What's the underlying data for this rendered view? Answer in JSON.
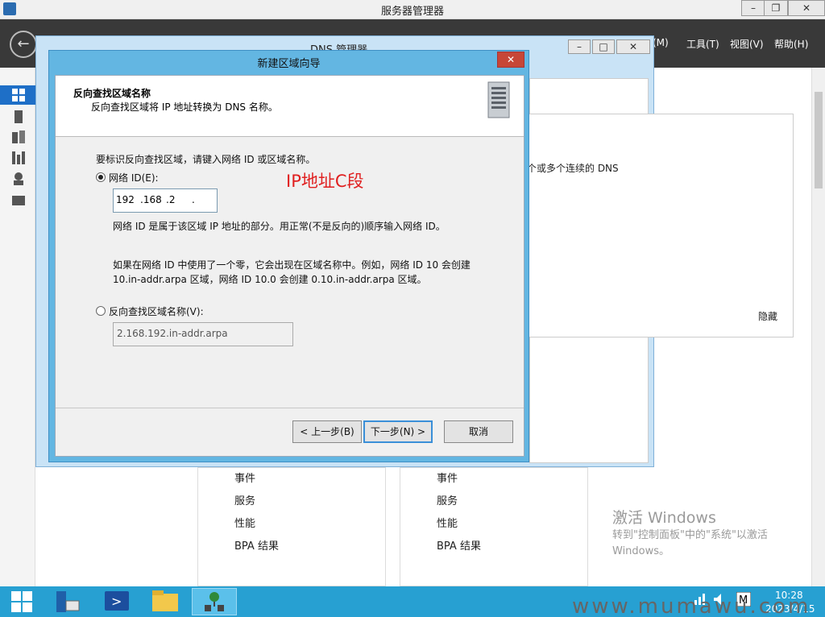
{
  "server_manager": {
    "title": "服务器管理器",
    "menus": [
      "(M)",
      "工具(T)",
      "视图(V)",
      "帮助(H)"
    ],
    "tiles": [
      {
        "items": [
          "事件",
          "服务",
          "性能",
          "BPA 结果"
        ]
      },
      {
        "items": [
          "事件",
          "服务",
          "性能",
          "BPA 结果"
        ]
      }
    ],
    "activation": {
      "line1": "激活 Windows",
      "line2": "转到\"控制面板\"中的\"系统\"以激活",
      "line3": "Windows。"
    }
  },
  "dns_manager": {
    "title": "DNS 管理器",
    "panel_text": "个或多个连续的 DNS",
    "hide_label": "隐藏"
  },
  "wizard": {
    "title": "新建区域向导",
    "close_glyph": "✕",
    "header_title": "反向查找区域名称",
    "header_subtitle": "反向查找区域将 IP 地址转换为 DNS 名称。",
    "instruction": "要标识反向查找区域，请键入网络 ID 或区域名称。",
    "network_id_label": "网络 ID(E):",
    "ip_octets": [
      "192",
      ".168",
      ".2",
      "."
    ],
    "annotation": "IP地址C段",
    "network_id_note": "网络 ID 是属于该区域 IP 地址的部分。用正常(不是反向的)顺序输入网络 ID。",
    "zero_note_line1": "如果在网络 ID 中使用了一个零，它会出现在区域名称中。例如，网络 ID 10 会创建",
    "zero_note_line2": "10.in-addr.arpa 区域，网络 ID 10.0 会创建 0.10.in-addr.arpa 区域。",
    "zone_name_label": "反向查找区域名称(V):",
    "zone_name_value": "2.168.192.in-addr.arpa",
    "buttons": {
      "back": "< 上一步(B)",
      "next": "下一步(N) >",
      "cancel": "取消"
    }
  },
  "taskbar": {
    "time": "10:28",
    "date": "2023/4/15"
  },
  "watermark": "www.mumawu.com"
}
